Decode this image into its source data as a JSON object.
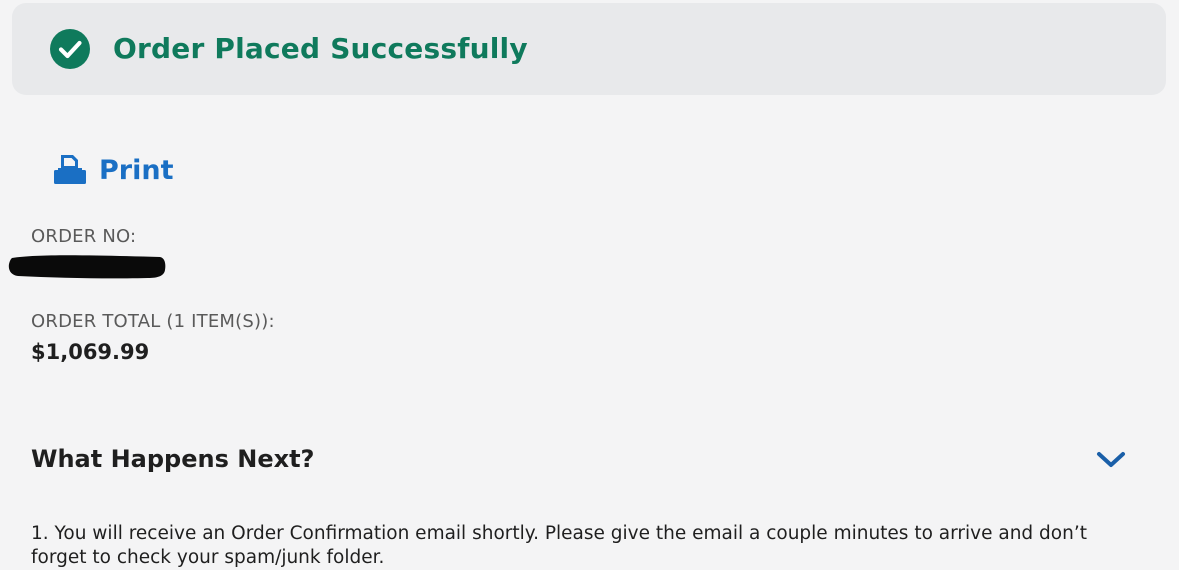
{
  "banner": {
    "icon": "check-circle-icon",
    "title": "Order Placed Successfully",
    "color": "#0f7a5c"
  },
  "print": {
    "icon": "printer-icon",
    "label": "Print",
    "color": "#1a6fc4"
  },
  "order": {
    "number_label": "ORDER NO:",
    "total_label": "ORDER TOTAL  (1 ITEM(S)):",
    "total_value": "$1,069.99"
  },
  "next": {
    "heading": "What Happens Next?",
    "toggle_icon": "chevron-down-icon",
    "steps": [
      "1.  You will receive an Order Confirmation email shortly. Please give the email a couple minutes to arrive and don’t forget to check your spam/junk folder."
    ]
  }
}
